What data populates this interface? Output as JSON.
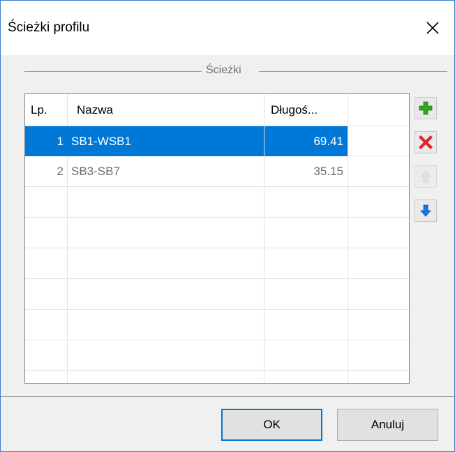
{
  "dialog": {
    "title": "Ścieżki profilu",
    "close_icon": "close-icon"
  },
  "group": {
    "label": "Ścieżki"
  },
  "table": {
    "columns": [
      "Lp.",
      "Nazwa",
      "Długoś..."
    ],
    "rows": [
      {
        "lp": "1",
        "nazwa": "SB1-WSB1",
        "dlugosc": "69.41",
        "selected": true
      },
      {
        "lp": "2",
        "nazwa": "SB3-SB7",
        "dlugosc": "35.15",
        "selected": false
      }
    ]
  },
  "side_buttons": [
    {
      "icon": "add-icon",
      "enabled": true
    },
    {
      "icon": "delete-icon",
      "enabled": true
    },
    {
      "icon": "arrow-up-icon",
      "enabled": false
    },
    {
      "icon": "arrow-down-icon",
      "enabled": true
    }
  ],
  "buttons": {
    "ok": "OK",
    "cancel": "Anuluj"
  },
  "colors": {
    "selection": "#0078d7",
    "window_border": "#3f7dc6",
    "add": "#2fa81b",
    "delete": "#e8202a",
    "arrow": "#1a73e8"
  }
}
